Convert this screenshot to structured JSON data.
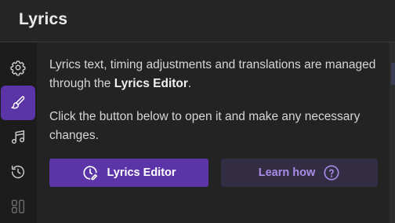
{
  "header": {
    "title": "Lyrics"
  },
  "sidebar": {
    "items": [
      {
        "icon": "gear-icon",
        "active": false
      },
      {
        "icon": "brush-icon",
        "active": true
      },
      {
        "icon": "music-note-icon",
        "active": false
      },
      {
        "icon": "history-icon",
        "active": false
      },
      {
        "icon": "grid-icon",
        "active": false
      }
    ]
  },
  "main": {
    "paragraph1_part1": "Lyrics text, timing adjustments and translations are managed through the ",
    "paragraph1_bold": "Lyrics Editor",
    "paragraph1_end": ".",
    "paragraph2": "Click the button below to open it and make any necessary changes.",
    "primary_button": {
      "label": "Lyrics Editor",
      "icon": "clock-edit-icon"
    },
    "secondary_button": {
      "label": "Learn how",
      "icon": "question-circle-icon"
    }
  },
  "colors": {
    "accent": "#5b35a8",
    "secondary_bg": "#322d42",
    "secondary_text": "#a88ce6"
  }
}
